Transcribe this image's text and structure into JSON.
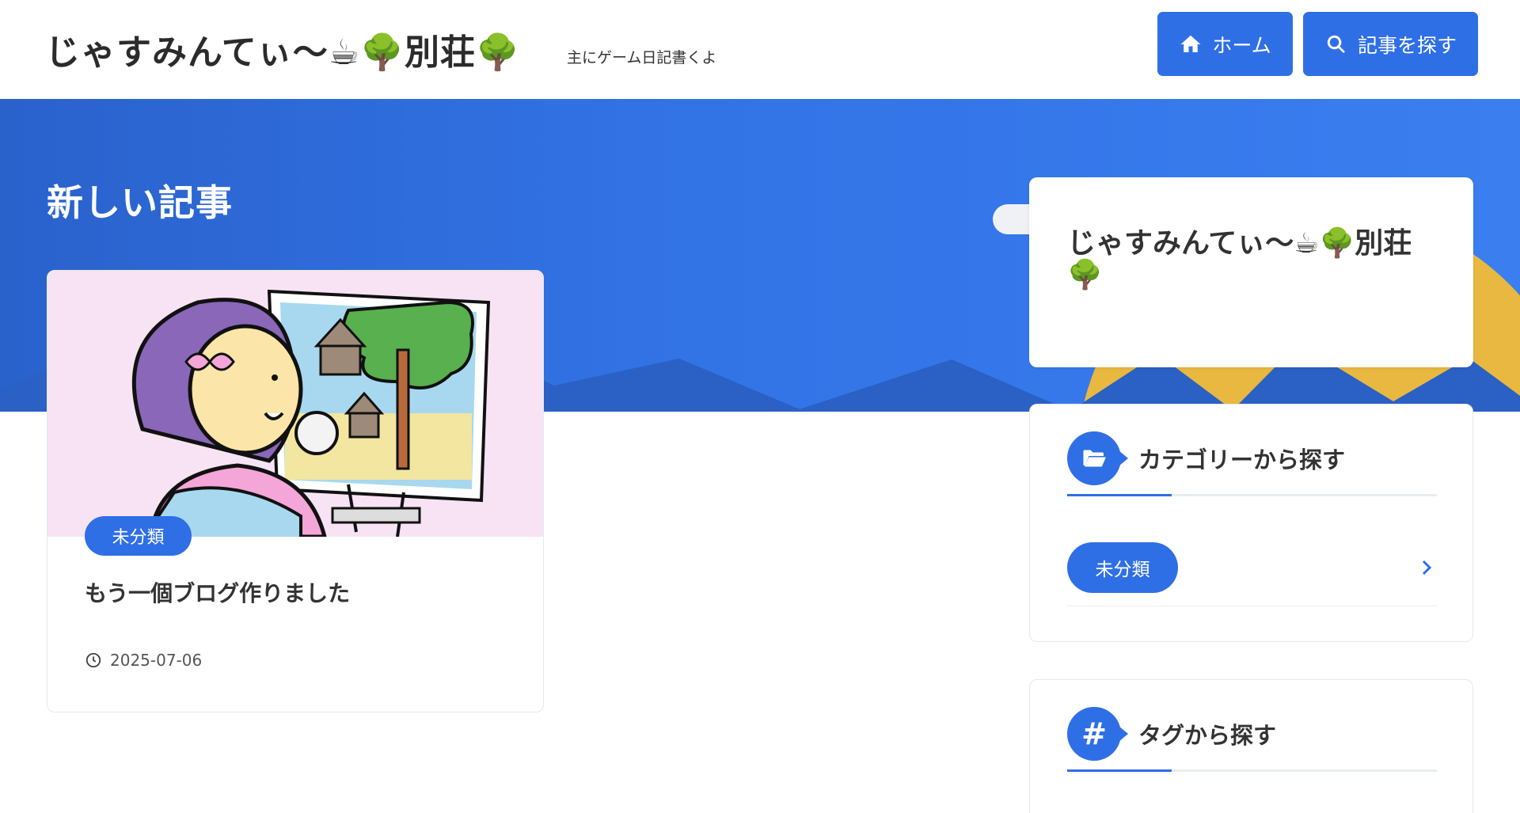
{
  "header": {
    "site_title": "じゃすみんてぃ〜☕🌳別荘🌳",
    "site_description": "主にゲーム日記書くよ",
    "nav": {
      "home_label": "ホーム",
      "search_label": "記事を探す"
    }
  },
  "main": {
    "section_title": "新しい記事",
    "articles": [
      {
        "category": "未分類",
        "title": "もう一個ブログ作りました",
        "date": "2025-07-06"
      }
    ]
  },
  "sidebar": {
    "profile_name": "じゃすみんてぃ〜☕🌳別荘🌳",
    "category_widget": {
      "title": "カテゴリーから探す",
      "items": [
        {
          "label": "未分類"
        }
      ]
    },
    "tag_widget": {
      "title": "タグから探す"
    }
  },
  "colors": {
    "accent": "#2f6fe6",
    "hero_blue": "#3273e6",
    "sun_yellow": "#e8b840",
    "thumb_pink": "#f7e3f4"
  },
  "icons": [
    "home-icon",
    "search-icon",
    "clock-icon",
    "folder-open-icon",
    "hash-icon",
    "chevron-right-icon"
  ]
}
